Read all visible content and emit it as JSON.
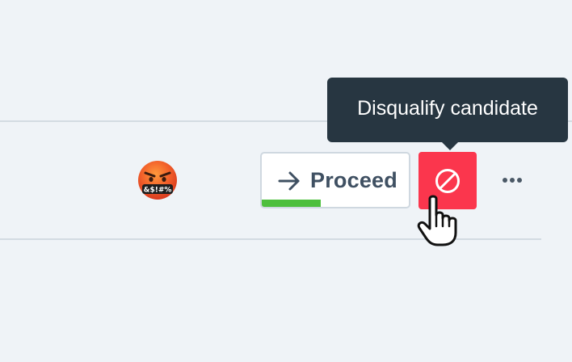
{
  "row": {
    "reaction_emoji": "🤬",
    "proceed_button": {
      "label": "Proceed",
      "icon": "arrow-right-icon",
      "progress_percent": 40,
      "progress_color": "#4dbf3d"
    },
    "disqualify_button": {
      "icon": "prohibited-icon",
      "color": "#fb364d"
    },
    "more_button": {
      "icon": "more-horizontal-icon"
    }
  },
  "tooltip": {
    "text": "Disqualify candidate"
  },
  "cursor": {
    "icon": "hand-pointer-icon"
  }
}
